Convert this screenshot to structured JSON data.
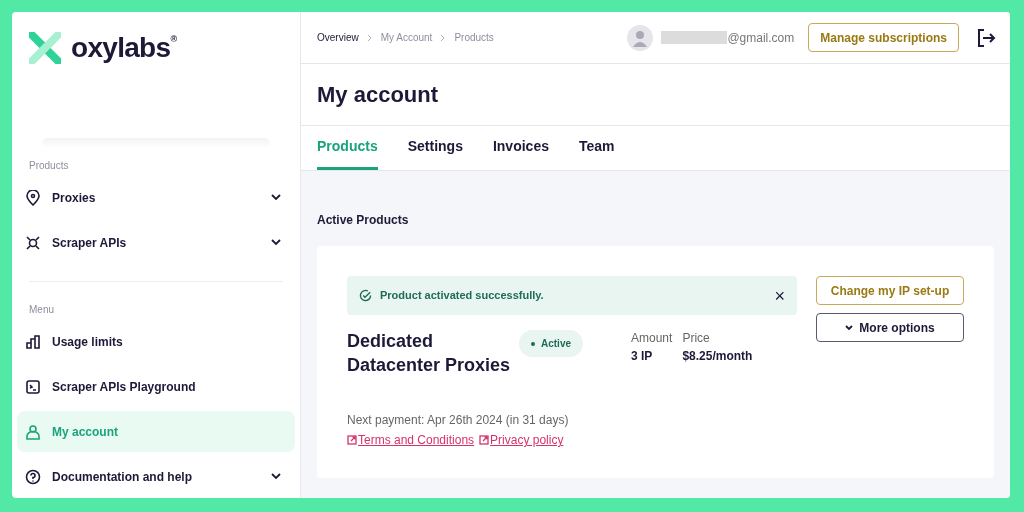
{
  "logo": {
    "text": "oxylabs",
    "mark": "®"
  },
  "breadcrumb": [
    {
      "label": "Overview"
    },
    {
      "label": "My Account"
    },
    {
      "label": "Products"
    }
  ],
  "user": {
    "email": "@gmail.com"
  },
  "header_button": "Manage subscriptions",
  "sidebar": [
    {
      "heading": "Products",
      "items": [
        {
          "label": "Proxies",
          "kind": "pin",
          "has_submenu": true,
          "selected": false
        },
        {
          "label": "Scraper APIs",
          "kind": "spider",
          "has_submenu": true,
          "selected": false
        }
      ]
    },
    {
      "heading": "Menu",
      "items": [
        {
          "label": "Usage limits",
          "kind": "chart",
          "has_submenu": false,
          "selected": false
        },
        {
          "label": "Scraper APIs Playground",
          "kind": "terminal",
          "has_submenu": false,
          "selected": false
        },
        {
          "label": "My account",
          "kind": "person",
          "has_submenu": false,
          "selected": true
        },
        {
          "label": "Documentation and help",
          "kind": "help",
          "has_submenu": true,
          "selected": false
        }
      ]
    }
  ],
  "page_title": "My account",
  "tabs": [
    {
      "label": "Products",
      "selected": true
    },
    {
      "label": "Settings",
      "selected": false
    },
    {
      "label": "Invoices",
      "selected": false
    },
    {
      "label": "Team",
      "selected": false
    }
  ],
  "section_title": "Active Products",
  "alert": {
    "text": "Product activated successfully.",
    "close": "×"
  },
  "product": {
    "name": "Dedicated Datacenter Proxies",
    "status": "Active",
    "amount_label": "Amount",
    "amount": "3 IP",
    "price_label": "Price",
    "price": "$8.25/month",
    "next_payment": "Next payment: Apr 26th 2024 (in 31 days)",
    "links": [
      "Terms and Conditions",
      "Privacy policy"
    ]
  },
  "actions": [
    {
      "label": "Change my IP set-up",
      "kind": "primary"
    },
    {
      "label": "More options",
      "kind": "dropdown"
    }
  ]
}
